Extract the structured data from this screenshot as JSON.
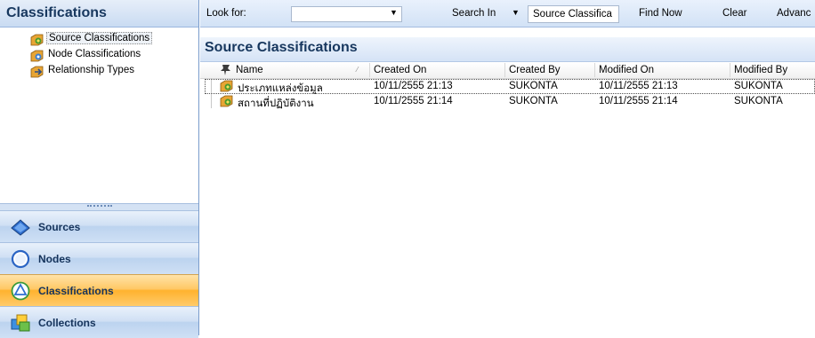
{
  "nav": {
    "header": "Classifications",
    "tree": [
      {
        "label": "Source Classifications",
        "icon": "source-classification-icon",
        "selected": true
      },
      {
        "label": "Node Classifications",
        "icon": "node-classification-icon",
        "selected": false
      },
      {
        "label": "Relationship Types",
        "icon": "relationship-type-icon",
        "selected": false
      }
    ],
    "buttons": [
      {
        "label": "Sources",
        "icon": "sources-icon",
        "active": false
      },
      {
        "label": "Nodes",
        "icon": "nodes-icon",
        "active": false
      },
      {
        "label": "Classifications",
        "icon": "classifications-icon",
        "active": true
      },
      {
        "label": "Collections",
        "icon": "collections-icon",
        "active": false
      }
    ]
  },
  "toolbar": {
    "look_for_label": "Look for:",
    "look_for_value": "",
    "search_in_label": "Search In",
    "search_in_value": "Source Classifica",
    "find_now_label": "Find Now",
    "clear_label": "Clear",
    "advanced_label": "Advanc"
  },
  "content": {
    "title": "Source Classifications",
    "columns": [
      "Name",
      "Created On",
      "Created By",
      "Modified On",
      "Modified By"
    ],
    "rows": [
      {
        "name": "ประเภทแหล่งข้อมูล",
        "created_on": "10/11/2555 21:13",
        "created_by": "SUKONTA",
        "modified_on": "10/11/2555 21:13",
        "modified_by": "SUKONTA"
      },
      {
        "name": "สถานที่ปฏิบัติงาน",
        "created_on": "10/11/2555 21:14",
        "created_by": "SUKONTA",
        "modified_on": "10/11/2555 21:14",
        "modified_by": "SUKONTA"
      }
    ]
  },
  "colors": {
    "header_text": "#17375e",
    "active_button": "#ffc865",
    "pane_blue": "#c9dbf2"
  }
}
